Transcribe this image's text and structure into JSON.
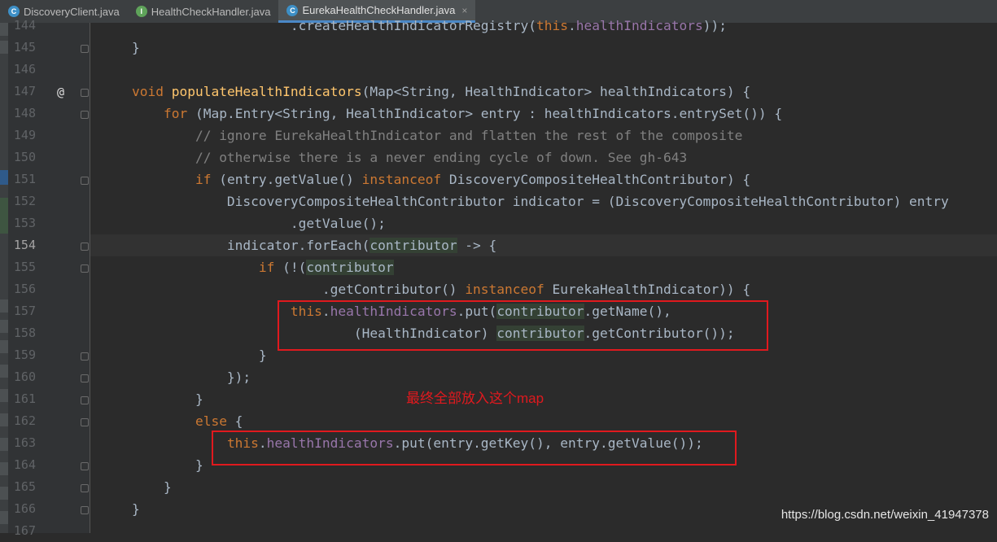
{
  "tabs": [
    {
      "label": "DiscoveryClient.java",
      "icon": "class-icon"
    },
    {
      "label": "HealthCheckHandler.java",
      "icon": "interface-icon"
    },
    {
      "label": "EurekaHealthCheckHandler.java",
      "icon": "class-icon",
      "active": true
    }
  ],
  "close_glyph": "×",
  "lines": [
    {
      "n": "144",
      "html": "                        <span>.createHealthIndicatorRegistry(</span><span class=\"kw\">this</span>.<span class=\"fld\">healthIndicators</span>));"
    },
    {
      "n": "145",
      "html": "    }"
    },
    {
      "n": "146",
      "html": ""
    },
    {
      "n": "147",
      "html": "    <span class=\"kw\">void</span> <span class=\"fn\">populateHealthIndicators</span>(Map&lt;String, HealthIndicator&gt; healthIndicators) {"
    },
    {
      "n": "148",
      "html": "        <span class=\"kw\">for</span> (Map.Entry&lt;String, HealthIndicator&gt; entry : healthIndicators.entrySet()) {"
    },
    {
      "n": "149",
      "html": "            <span class=\"cm\">// ignore EurekaHealthIndicator and flatten the rest of the composite</span>"
    },
    {
      "n": "150",
      "html": "            <span class=\"cm\">// otherwise there is a never ending cycle of down. See gh-643</span>"
    },
    {
      "n": "151",
      "html": "            <span class=\"kw\">if</span> (entry.getValue() <span class=\"kw\">instanceof</span> DiscoveryCompositeHealthContributor) {"
    },
    {
      "n": "152",
      "html": "                DiscoveryCompositeHealthContributor indicator = (DiscoveryCompositeHealthContributor) entry"
    },
    {
      "n": "153",
      "html": "                        .getValue();"
    },
    {
      "n": "154",
      "html": "                indicator.forEach(<span class=\"lam\">contributor</span> -&gt; {"
    },
    {
      "n": "155",
      "html": "                    <span class=\"kw\">if</span> (!(<span class=\"lam\">contributor</span>"
    },
    {
      "n": "156",
      "html": "                            .getContributor() <span class=\"kw\">instanceof</span> EurekaHealthIndicator)) {"
    },
    {
      "n": "157",
      "html": "                        <span class=\"kw\">this</span>.<span class=\"fld\">healthIndicators</span>.put(<span class=\"lam\">contributor</span>.getName(),"
    },
    {
      "n": "158",
      "html": "                                (HealthIndicator) <span class=\"lam\">contributor</span>.getContributor());"
    },
    {
      "n": "159",
      "html": "                    }"
    },
    {
      "n": "160",
      "html": "                });"
    },
    {
      "n": "161",
      "html": "            }"
    },
    {
      "n": "162",
      "html": "            <span class=\"kw\">else</span> {"
    },
    {
      "n": "163",
      "html": "                <span class=\"kw\">this</span>.<span class=\"fld\">healthIndicators</span>.put(entry.getKey(), entry.getValue());"
    },
    {
      "n": "164",
      "html": "            }"
    },
    {
      "n": "165",
      "html": "        }"
    },
    {
      "n": "166",
      "html": "    }"
    },
    {
      "n": "167",
      "html": ""
    }
  ],
  "override_marker": "@",
  "current_line": "154",
  "annotation": "最终全部放入这个map",
  "watermark": "https://blog.csdn.net/weixin_41947378",
  "colors": {
    "highlight_box": "#e0191e",
    "keyword": "#cc7832",
    "method": "#ffc66d",
    "field": "#9876aa",
    "comment": "#808080"
  }
}
